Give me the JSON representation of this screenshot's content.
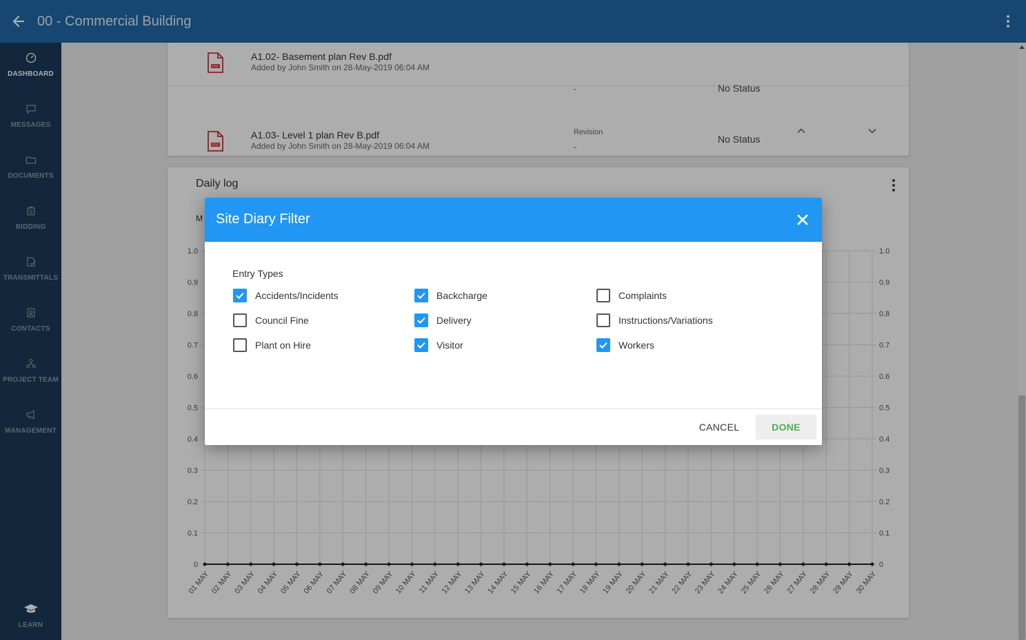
{
  "header": {
    "title": "00 - Commercial Building"
  },
  "sidebar": {
    "items": [
      {
        "label": "DASHBOARD",
        "icon": "dashboard-icon",
        "active": true
      },
      {
        "label": "MESSAGES",
        "icon": "message-icon"
      },
      {
        "label": "DOCUMENTS",
        "icon": "folder-icon"
      },
      {
        "label": "BIDDING",
        "icon": "bidding-icon"
      },
      {
        "label": "TRANSMITTALS",
        "icon": "transmittal-icon"
      },
      {
        "label": "CONTACTS",
        "icon": "contacts-icon"
      },
      {
        "label": "PROJECT TEAM",
        "icon": "team-icon"
      },
      {
        "label": "MANAGEMENT",
        "icon": "megaphone-icon"
      }
    ],
    "learn": {
      "label": "LEARN",
      "icon": "graduation-cap-icon"
    }
  },
  "documents": {
    "rows": [
      {
        "name": "A1.02- Basement plan Rev B.pdf",
        "added": "Added by John Smith on 28-May-2019 06:04 AM",
        "revision_label": "",
        "revision_value": "-",
        "status": "No Status"
      },
      {
        "name": "A1.03- Level 1 plan Rev B.pdf",
        "added": "Added by John Smith on 28-May-2019 06:04 AM",
        "revision_label": "Revision",
        "revision_value": "-",
        "status": "No Status"
      }
    ]
  },
  "daily_log": {
    "title": "Daily log",
    "subtitle_partial": "M"
  },
  "chart_data": {
    "type": "line",
    "title": "",
    "x": [
      "01 MAY",
      "02 MAY",
      "03 MAY",
      "04 MAY",
      "05 MAY",
      "06 MAY",
      "07 MAY",
      "08 MAY",
      "09 MAY",
      "10 MAY",
      "11 MAY",
      "12 MAY",
      "13 MAY",
      "14 MAY",
      "15 MAY",
      "16 MAY",
      "17 MAY",
      "18 MAY",
      "19 MAY",
      "20 MAY",
      "21 MAY",
      "22 MAY",
      "23 MAY",
      "24 MAY",
      "25 MAY",
      "26 MAY",
      "27 MAY",
      "28 MAY",
      "29 MAY",
      "30 MAY"
    ],
    "series": [
      {
        "values": [
          0,
          0,
          0,
          0,
          0,
          0,
          0,
          0,
          0,
          0,
          0,
          0,
          0,
          0,
          0,
          0,
          0,
          0,
          0,
          0,
          0,
          0,
          0,
          0,
          0,
          0,
          0,
          0,
          0,
          0
        ]
      }
    ],
    "yticks": [
      "0",
      "0.1",
      "0.2",
      "0.3",
      "0.4",
      "0.5",
      "0.6",
      "0.7",
      "0.8",
      "0.9",
      "1.0"
    ],
    "ylim": [
      0,
      1.0
    ],
    "grid": true,
    "colors": {
      "line": "#222222",
      "grid": "#e0e0e0"
    }
  },
  "modal": {
    "title": "Site Diary Filter",
    "section_title": "Entry Types",
    "options": [
      {
        "label": "Accidents/Incidents",
        "checked": true
      },
      {
        "label": "Backcharge",
        "checked": true
      },
      {
        "label": "Complaints",
        "checked": false
      },
      {
        "label": "Council Fine",
        "checked": false
      },
      {
        "label": "Delivery",
        "checked": true
      },
      {
        "label": "Instructions/Variations",
        "checked": false
      },
      {
        "label": "Plant on Hire",
        "checked": false
      },
      {
        "label": "Visitor",
        "checked": true
      },
      {
        "label": "Workers",
        "checked": true
      }
    ],
    "cancel_label": "CANCEL",
    "done_label": "DONE"
  },
  "colors": {
    "topbar": "#1f69a8",
    "sidebar": "#1c3a59",
    "modal_header": "#2196f3",
    "checkbox_checked": "#2196f3",
    "done_text": "#4caf50",
    "pdf_icon": "#d32f2f"
  }
}
